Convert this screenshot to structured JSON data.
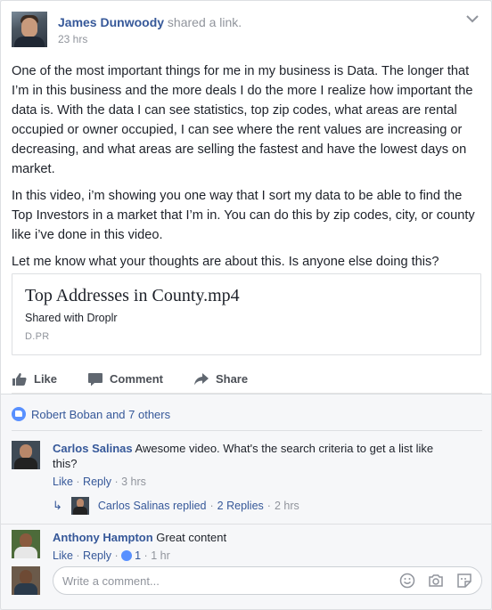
{
  "post": {
    "author": "James Dunwoody",
    "action": "shared a link.",
    "time": "23 hrs",
    "paragraphs": [
      "One of the most important things for me in my business is Data. The longer that I’m in this business and the more deals I do the more I realize how important the data is. With the data I can see statistics, top zip codes, what areas are rental occupied or owner occupied, I can see where the rent values are increasing or decreasing, and what areas are selling the fastest and have the lowest days on market.",
      "In this video, i’m showing you one way that I sort my data to be able to find the Top Investors in a market that I’m in. You can do this by zip codes, city, or county like i’ve done in this video.",
      "Let me know what your thoughts are about this. Is anyone else doing this?"
    ],
    "link": {
      "title": "Top Addresses in County.mp4",
      "description": "Shared with Droplr",
      "domain": "D.PR"
    }
  },
  "actions": {
    "like": "Like",
    "comment": "Comment",
    "share": "Share"
  },
  "reactions": {
    "text": "Robert Boban and 7 others"
  },
  "comments": [
    {
      "name": "Carlos Salinas",
      "text": "Awesome video. What's the search criteria to get a list like this?",
      "like": "Like",
      "reply": "Reply",
      "time": "3 hrs"
    },
    {
      "name": "Anthony Hampton",
      "text": "Great content",
      "like": "Like",
      "reply": "Reply",
      "likes": "1",
      "time": "1 hr"
    }
  ],
  "reply_summary": {
    "text": "Carlos Salinas replied",
    "count": "2 Replies",
    "time": "2 hrs"
  },
  "composer": {
    "placeholder": "Write a comment..."
  },
  "colors": {
    "link_blue": "#365899",
    "meta_gray": "#90949c",
    "like_blue": "#5890ff"
  }
}
